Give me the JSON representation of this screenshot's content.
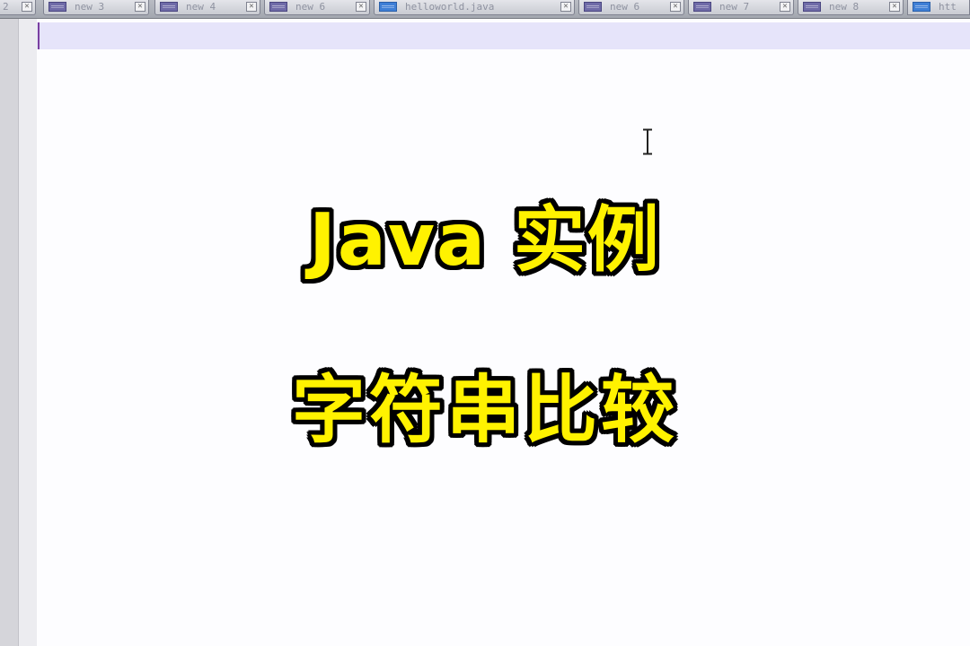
{
  "tabs": [
    {
      "label": "2",
      "kind": "text",
      "active": false
    },
    {
      "label": "new 3",
      "kind": "text",
      "active": false
    },
    {
      "label": "new 4",
      "kind": "text",
      "active": false
    },
    {
      "label": "new 6",
      "kind": "text",
      "active": false
    },
    {
      "label": "helloworld.java",
      "kind": "java",
      "active": false
    },
    {
      "label": "new 6",
      "kind": "text",
      "active": false
    },
    {
      "label": "new 7",
      "kind": "text",
      "active": false
    },
    {
      "label": "new 8",
      "kind": "text",
      "active": false
    },
    {
      "label": "htt",
      "kind": "java",
      "active": false
    }
  ],
  "tab_close_glyph": "✕",
  "overlay": {
    "line1": "Java 实例",
    "line2": "字符串比较"
  },
  "colors": {
    "overlay_text": "#fff200",
    "overlay_outline": "#000000",
    "current_line": "#e6e4fa",
    "caret": "#7a3fa0"
  },
  "icons": {
    "tab_file": "document-icon",
    "tab_close": "close-icon",
    "pointer": "text-cursor-icon"
  }
}
